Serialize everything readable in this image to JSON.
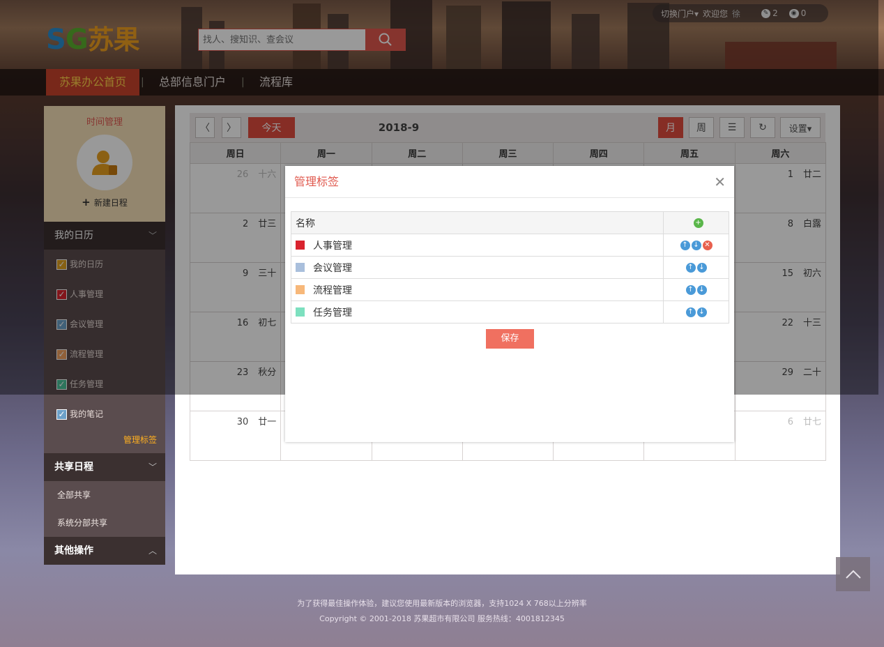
{
  "header": {
    "logo_text": "SG",
    "logo_cn": "苏果",
    "search_placeholder": "找人、搜知识、查会议",
    "switch_portal": "切换门户▾",
    "welcome": "欢迎您",
    "user_name": "徐",
    "tasks_count": "2",
    "views_count": "0"
  },
  "nav": {
    "items": [
      {
        "label": "苏果办公首页"
      },
      {
        "label": "总部信息门户"
      },
      {
        "label": "流程库"
      }
    ]
  },
  "sidebar": {
    "title": "时间管理",
    "new_event": "新建日程",
    "my_calendar_title": "我的日历",
    "my_calendar_items": [
      {
        "label": "我的日历",
        "color": "#e0a020"
      },
      {
        "label": "人事管理",
        "color": "#d9232e"
      },
      {
        "label": "会议管理",
        "color": "#6ca0c8"
      },
      {
        "label": "流程管理",
        "color": "#f0a060"
      },
      {
        "label": "任务管理",
        "color": "#4cc29a"
      },
      {
        "label": "我的笔记",
        "color": "#6ca0c8"
      }
    ],
    "manage_tags": "管理标签",
    "shared_title": "共享日程",
    "shared_items": [
      {
        "label": "全部共享"
      },
      {
        "label": "系统分部共享"
      }
    ],
    "other_title": "其他操作"
  },
  "calendar": {
    "today": "今天",
    "month_title": "2018-9",
    "view_month": "月",
    "view_week": "周",
    "settings": "设置▾",
    "weekdays": [
      "周日",
      "周一",
      "周二",
      "周三",
      "周四",
      "周五",
      "周六"
    ],
    "weeks": [
      [
        {
          "d": "26",
          "l": "十六",
          "om": true
        },
        {
          "d": "",
          "l": ""
        },
        {
          "d": "",
          "l": ""
        },
        {
          "d": "",
          "l": ""
        },
        {
          "d": "",
          "l": ""
        },
        {
          "d": "",
          "l": ""
        },
        {
          "d": "1",
          "l": "廿二"
        }
      ],
      [
        {
          "d": "2",
          "l": "廿三"
        },
        {
          "d": "",
          "l": ""
        },
        {
          "d": "",
          "l": ""
        },
        {
          "d": "",
          "l": ""
        },
        {
          "d": "",
          "l": ""
        },
        {
          "d": "",
          "l": ""
        },
        {
          "d": "8",
          "l": "白露"
        }
      ],
      [
        {
          "d": "9",
          "l": "三十"
        },
        {
          "d": "",
          "l": ""
        },
        {
          "d": "",
          "l": ""
        },
        {
          "d": "",
          "l": ""
        },
        {
          "d": "",
          "l": ""
        },
        {
          "d": "",
          "l": ""
        },
        {
          "d": "15",
          "l": "初六"
        }
      ],
      [
        {
          "d": "16",
          "l": "初七"
        },
        {
          "d": "",
          "l": ""
        },
        {
          "d": "",
          "l": ""
        },
        {
          "d": "",
          "l": ""
        },
        {
          "d": "",
          "l": ""
        },
        {
          "d": "",
          "l": ""
        },
        {
          "d": "22",
          "l": "十三"
        }
      ],
      [
        {
          "d": "23",
          "l": "秋分"
        },
        {
          "d": "",
          "l": ""
        },
        {
          "d": "",
          "l": ""
        },
        {
          "d": "",
          "l": ""
        },
        {
          "d": "",
          "l": ""
        },
        {
          "d": "",
          "l": ""
        },
        {
          "d": "29",
          "l": "二十"
        }
      ],
      [
        {
          "d": "30",
          "l": "廿一"
        },
        {
          "d": "",
          "l": ""
        },
        {
          "d": "",
          "l": ""
        },
        {
          "d": "",
          "l": ""
        },
        {
          "d": "",
          "l": ""
        },
        {
          "d": "",
          "l": ""
        },
        {
          "d": "6",
          "l": "廿七",
          "om": true
        }
      ]
    ]
  },
  "modal": {
    "title": "管理标签",
    "col_name": "名称",
    "tags": [
      {
        "name": "人事管理",
        "color": "#d9232e",
        "deletable": true
      },
      {
        "name": "会议管理",
        "color": "#a9bfdc",
        "deletable": false
      },
      {
        "name": "流程管理",
        "color": "#f7b87a",
        "deletable": false
      },
      {
        "name": "任务管理",
        "color": "#7de0bf",
        "deletable": false
      }
    ],
    "save": "保存"
  },
  "footer": {
    "line1": "为了获得最佳操作体验，建议您使用最新版本的浏览器，支持1024 X 768以上分辨率",
    "line2": "Copyright © 2001-2018 苏果超市有限公司 服务热线：4001812345"
  }
}
